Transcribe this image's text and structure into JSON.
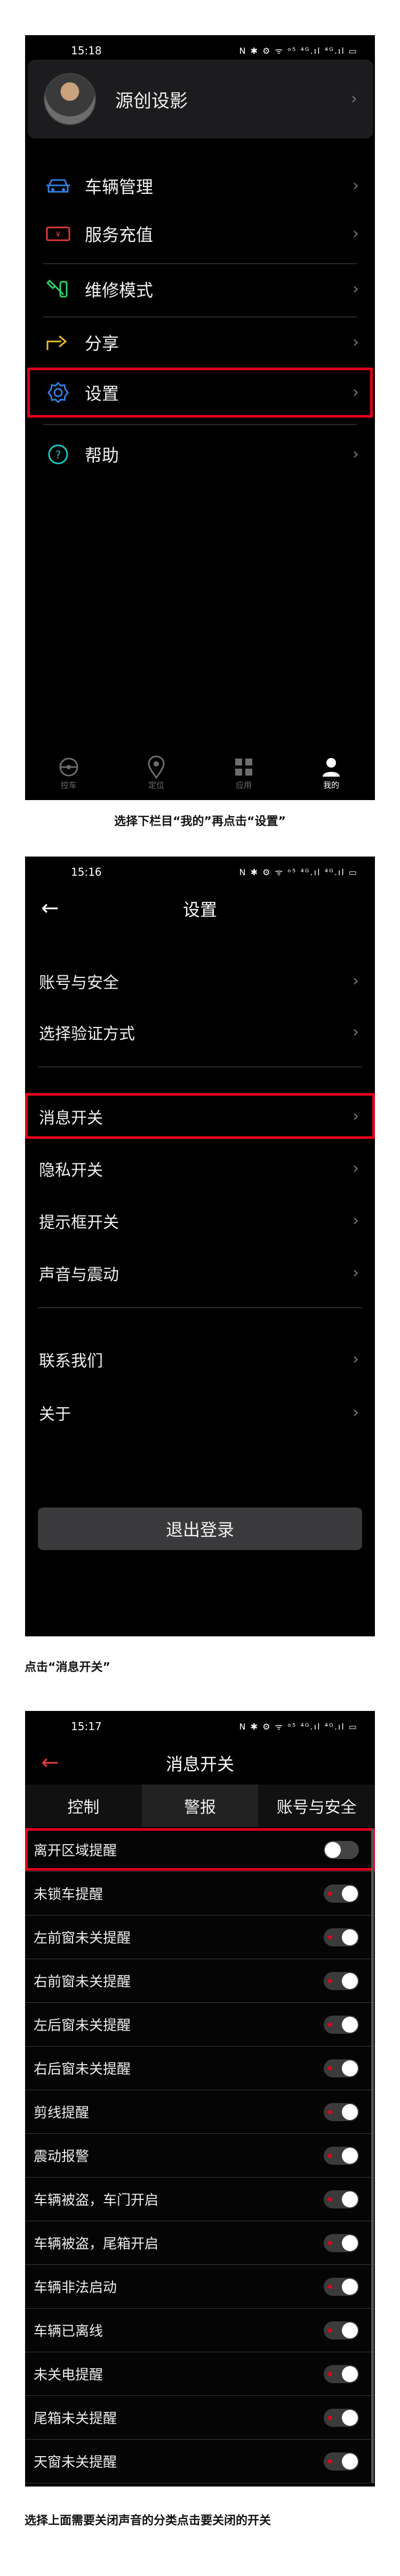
{
  "screen1": {
    "time": "15:18",
    "status_icons": "N ✱ ⚙ ᯤ ᵒ⁵ ⁴ᴳ.ıl ⁴ᴳ.ıl ▭",
    "profile_name": "源创设影",
    "menu": [
      {
        "label": "车辆管理",
        "icon": "car-icon"
      },
      {
        "label": "服务充值",
        "icon": "coupon-icon"
      },
      {
        "label": "维修模式",
        "icon": "wrench-icon"
      },
      {
        "label": "分享",
        "icon": "share-icon"
      },
      {
        "label": "设置",
        "icon": "gear-icon"
      },
      {
        "label": "帮助",
        "icon": "help-icon"
      }
    ],
    "tabs": [
      {
        "label": "控车",
        "icon": "steering-wheel-icon"
      },
      {
        "label": "定位",
        "icon": "location-pin-icon"
      },
      {
        "label": "应用",
        "icon": "apps-grid-icon"
      },
      {
        "label": "我的",
        "icon": "person-icon"
      }
    ],
    "caption": "选择下栏目“我的”再点击“设置”"
  },
  "screen2": {
    "time": "15:16",
    "status_icons": "N ✱ ⚙ ᯤ ᵒ⁵ ⁴ᴳ.ıl ⁴ᴳ.ıl ▭",
    "title": "设置",
    "items": [
      "账号与安全",
      "选择验证方式",
      "消息开关",
      "隐私开关",
      "提示框开关",
      "声音与震动",
      "联系我们",
      "关于"
    ],
    "logout": "退出登录",
    "caption": "点击“消息开关”"
  },
  "screen3": {
    "time": "15:17",
    "status_icons": "N ✱ ⚙ ᯤ ᵒ⁵ ⁴ᴳ.ıl ⁴ᴳ.ıl ▭",
    "title": "消息开关",
    "tabs": [
      "控制",
      "警报",
      "账号与安全"
    ],
    "rows": [
      {
        "label": "离开区域提醒",
        "on": false
      },
      {
        "label": "未锁车提醒",
        "on": true
      },
      {
        "label": "左前窗未关提醒",
        "on": true
      },
      {
        "label": "右前窗未关提醒",
        "on": true
      },
      {
        "label": "左后窗未关提醒",
        "on": true
      },
      {
        "label": "右后窗未关提醒",
        "on": true
      },
      {
        "label": "剪线提醒",
        "on": true
      },
      {
        "label": "震动报警",
        "on": true
      },
      {
        "label": "车辆被盗，车门开启",
        "on": true
      },
      {
        "label": "车辆被盗，尾箱开启",
        "on": true
      },
      {
        "label": "车辆非法启动",
        "on": true
      },
      {
        "label": "车辆已离线",
        "on": true
      },
      {
        "label": "未关电提醒",
        "on": true
      },
      {
        "label": "尾箱未关提醒",
        "on": true
      },
      {
        "label": "天窗未关提醒",
        "on": true
      }
    ],
    "caption": "选择上面需要关闭声音的分类点击要关闭的开关"
  },
  "colors": {
    "highlight": "#e0001b",
    "accent_blue": "#2f7fe0",
    "accent_green": "#2fd36b",
    "accent_yellow": "#f2c12e",
    "accent_red": "#e03a3a",
    "accent_cyan": "#18c7c7"
  }
}
